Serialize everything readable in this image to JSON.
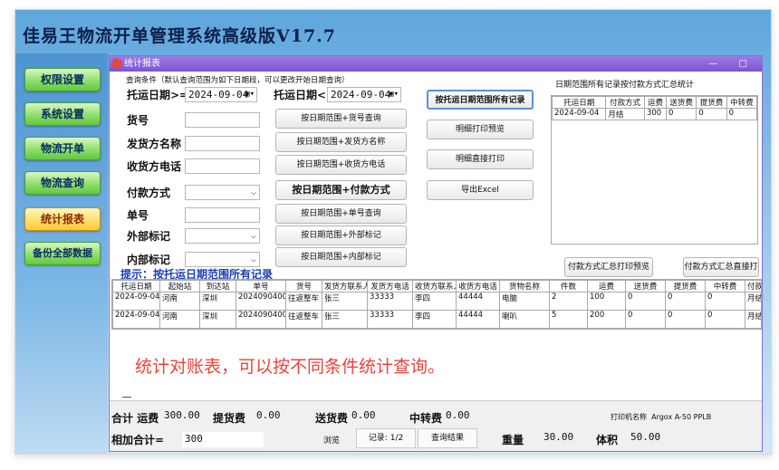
{
  "app_title": "佳易王物流开单管理系统高级版V17.7",
  "sidebar": [
    {
      "label": "权限设置",
      "active": false
    },
    {
      "label": "系统设置",
      "active": false
    },
    {
      "label": "物流开单",
      "active": false
    },
    {
      "label": "物流查询",
      "active": false
    },
    {
      "label": "统计报表",
      "active": true
    },
    {
      "label": "备份全部数据",
      "active": false
    }
  ],
  "window": {
    "title": "统计报表",
    "controls": "— □"
  },
  "query": {
    "hint": "查询条件（默认查询范围为如下日期段，可以更改开始日期查询）",
    "date_from_label": "托运日期>=",
    "date_from": "2024-09-04",
    "date_to_label": "托运日期<=",
    "date_to": "2024-09-04",
    "fields": {
      "goods": "货号",
      "shipper": "发货方名称",
      "receiver_phone": "收货方电话",
      "payment": "付款方式",
      "order_no": "单号",
      "external_tag": "外部标记",
      "internal_tag": "内部标记"
    }
  },
  "buttons": {
    "by_date_goods": "按日期范围+货号查询",
    "by_date_shipper": "按日期范围+发货方名称",
    "by_date_recv_phone": "按日期范围+收货方电话",
    "by_date_payment": "按日期范围+付款方式",
    "by_date_order": "按日期范围+单号查询",
    "by_date_external": "按日期范围+外部标记",
    "by_date_internal": "按日期范围+内部标记",
    "all_records": "按托运日期范围所有记录",
    "detail_preview": "明细打印预览",
    "detail_print": "明细直接打印",
    "export": "导出Excel",
    "pay_preview": "付款方式汇总打印预览",
    "pay_print": "付款方式汇总直接打印"
  },
  "summary_panel": {
    "title": "日期范围所有记录按付款方式汇总统计",
    "columns": [
      "托运日期",
      "付款方式",
      "运费",
      "送货费",
      "提货费",
      "中转费"
    ],
    "rows": [
      [
        "2024-09-04",
        "月结",
        "300",
        "0",
        "0",
        "0"
      ]
    ]
  },
  "tip": "提示：按托运日期范围所有记录",
  "records": {
    "columns": [
      "托运日期",
      "起始站",
      "到达站",
      "单号",
      "货号",
      "发货方联系人",
      "发货方电话",
      "收货方联系人",
      "收货方电话",
      "货物名称",
      "件数",
      "运费",
      "送货费",
      "提货费",
      "中转费",
      "付款"
    ],
    "rows": [
      [
        "2024-09-04",
        "河南",
        "深圳",
        "202409040001",
        "往返整车",
        "张三",
        "33333",
        "李四",
        "44444",
        "电脑",
        "2",
        "100",
        "0",
        "0",
        "0",
        "月结"
      ],
      [
        "2024-09-04",
        "河南",
        "深圳",
        "202409040001",
        "往返整车",
        "张三",
        "33333",
        "李四",
        "44444",
        "喇叭",
        "5",
        "200",
        "0",
        "0",
        "0",
        "月结"
      ]
    ]
  },
  "overlay_text": "统计对账表，可以按不同条件统计查询。",
  "totals": {
    "label": "合计",
    "freight_label": "运费",
    "freight": "300.00",
    "pickup_label": "提货费",
    "pickup": "0.00",
    "delivery_label": "送货费",
    "delivery": "0.00",
    "transfer_label": "中转费",
    "transfer": "0.00",
    "printer_label": "打印机名称",
    "printer": "Argox A-50 PPLB",
    "sum_label": "相加合计=",
    "sum": "300",
    "browse": "浏览",
    "record": "记录: 1/2",
    "result": "查询结果",
    "weight_label": "重量",
    "weight": "30.00",
    "volume_label": "体积",
    "volume": "50.00"
  },
  "colors": {
    "accent": "#7b55cf",
    "nav_green": "#62c83e",
    "nav_active": "#ffc832",
    "tip": "#1a3fb5",
    "overlay": "#e8453c"
  }
}
